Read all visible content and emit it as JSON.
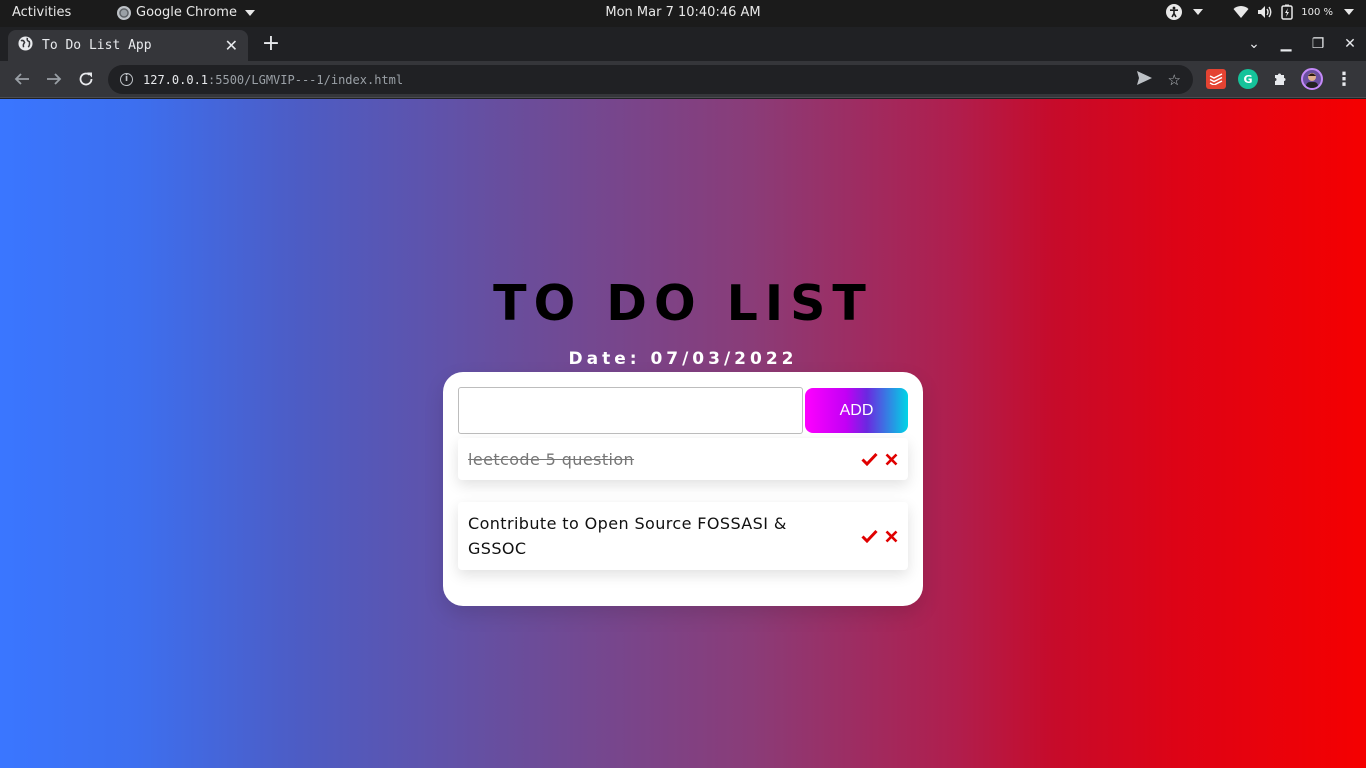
{
  "system_bar": {
    "activities": "Activities",
    "app_name": "Google Chrome",
    "clock": "Mon Mar 7 10:40:46 AM",
    "battery": "100 %"
  },
  "browser": {
    "tab_title": "To Do List App",
    "url_host": "127.0.0.1",
    "url_path": ":5500/LGMVIP---1/index.html"
  },
  "app": {
    "title": "TO DO LIST",
    "date": "Date: 07/03/2022",
    "input_value": "",
    "add_label": "ADD",
    "tasks": [
      {
        "text": "leetcode 5 question",
        "completed": true
      },
      {
        "text": "Contribute to Open Source FOSSASI & GSSOC",
        "completed": false
      }
    ]
  },
  "colors": {
    "gradient_left": "#3a76ff",
    "gradient_right": "#f50000",
    "action_red": "#e00000",
    "button_magenta": "#ff00ff",
    "button_cyan": "#00d5e6"
  },
  "icons": [
    "accessibility-icon",
    "wifi-icon",
    "volume-icon",
    "battery-icon",
    "globe-icon",
    "info-icon",
    "send-icon",
    "star-icon",
    "todoist-icon",
    "grammarly-icon",
    "extensions-icon",
    "check-icon",
    "close-icon"
  ]
}
